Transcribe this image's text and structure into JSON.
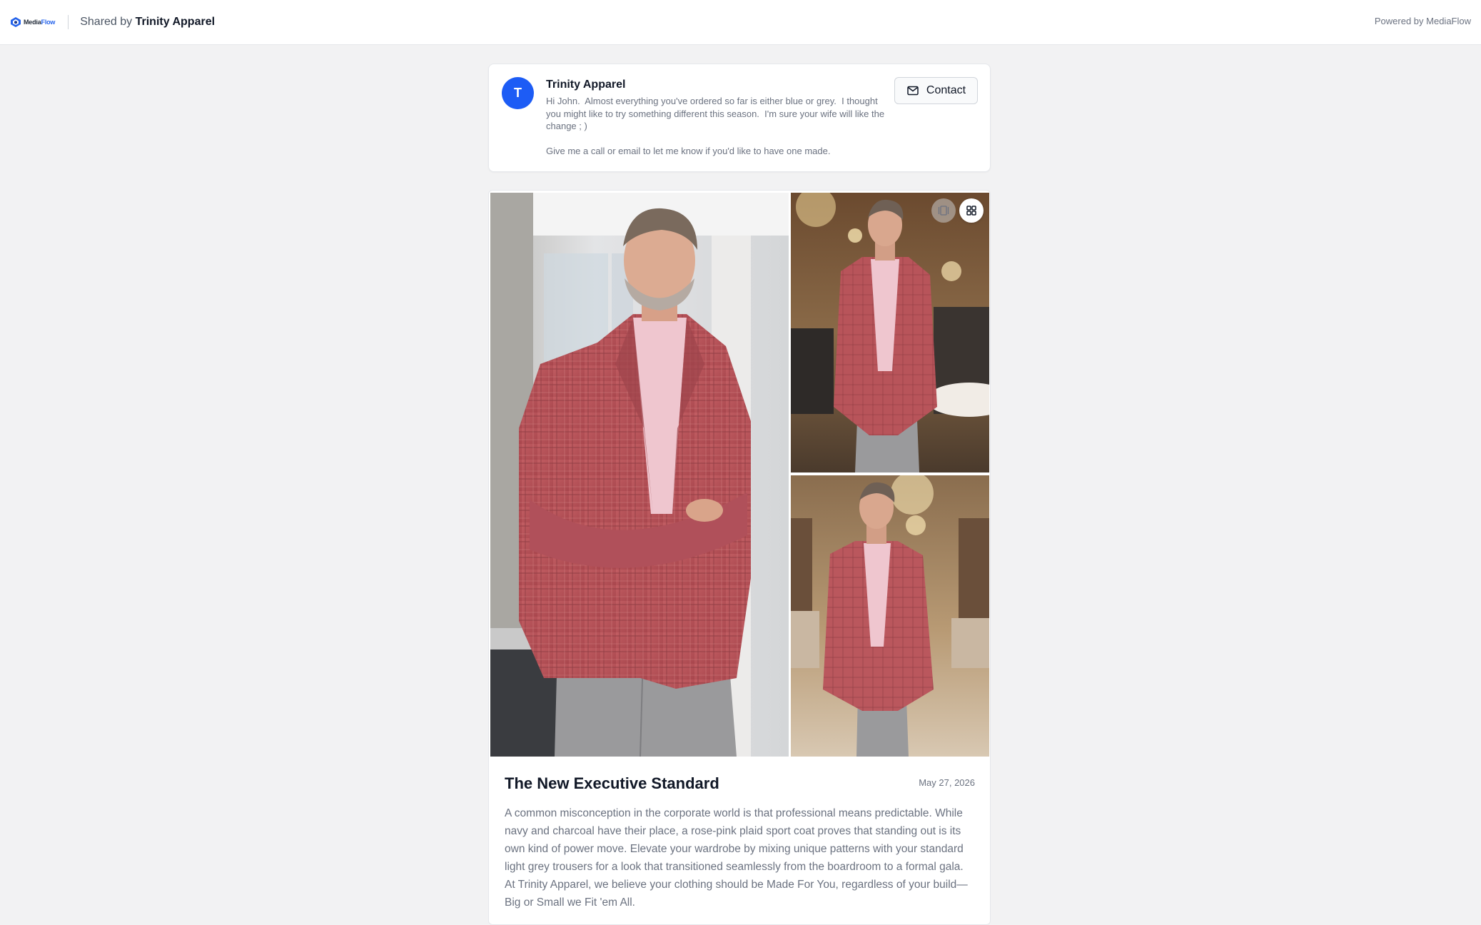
{
  "header": {
    "brand_main": "Media",
    "brand_accent": "Flow",
    "shared_prefix": "Shared by ",
    "shared_name": "Trinity Apparel",
    "powered": "Powered by MediaFlow"
  },
  "message": {
    "avatar_letter": "T",
    "sender": "Trinity Apparel",
    "body": "Hi John.  Almost everything you've ordered so far is either blue or grey.  I thought you might like to try something different this season.  I'm sure your wife will like the change ; )\n\nGive me a call or email to let me know if you'd like to have one made.",
    "contact_label": "Contact"
  },
  "post": {
    "title": "The New Executive Standard",
    "date": "May 27, 2026",
    "body": "A common misconception in the corporate world is that professional means predictable. While navy and charcoal have their place, a rose-pink plaid sport coat proves that standing out is its own kind of power move. Elevate your wardrobe by mixing unique patterns with your standard light grey trousers for a look that transitioned seamlessly from the boardroom to a formal gala. At Trinity Apparel, we believe your clothing should be Made For You, regardless of your build—Big or Small we Fit 'em All."
  },
  "colors": {
    "accent": "#1d5cf5",
    "jacket": "#b8545a",
    "trousers": "#9a9a9c",
    "shirt": "#efc6cf"
  },
  "icons": [
    "mediaflow-logo-icon",
    "mail-icon",
    "single-view-icon",
    "grid-view-icon"
  ]
}
